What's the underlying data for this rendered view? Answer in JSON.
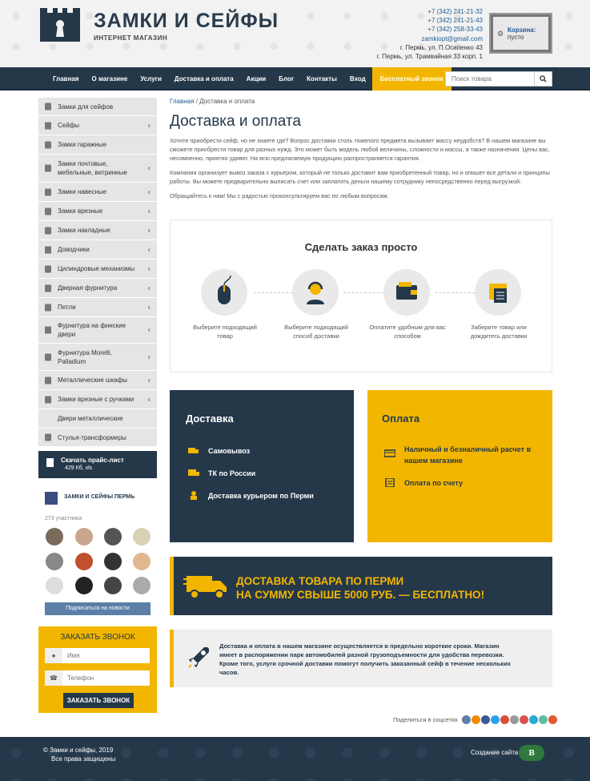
{
  "header": {
    "brand": "ЗАМКИ И СЕЙФЫ",
    "tagline": "ИНТЕРНЕТ МАГАЗИН",
    "phones": [
      "+7 (342) 241-21-32",
      "+7 (342) 241-21-43",
      "+7 (342) 258-33-43"
    ],
    "email": "zamkiopt@gmail.com",
    "addresses": [
      "г. Пермь, ул. П.Осипенко 43",
      "г. Пермь, ул. Трамвайная 33 корп. 1"
    ],
    "cart_title": "Корзина:",
    "cart_value": "пусто"
  },
  "nav": {
    "items": [
      "Главная",
      "О магазине",
      "Услуги",
      "Доставка и оплата",
      "Акции",
      "Блог",
      "Контакты",
      "Вход"
    ],
    "callback": "Бесплатный звонок",
    "search_placeholder": "Поиск товара"
  },
  "sidebar": {
    "items": [
      {
        "label": "Замки для сейфов",
        "sub": false
      },
      {
        "label": "Сейфы",
        "sub": true
      },
      {
        "label": "Замки гаражные",
        "sub": false
      },
      {
        "label": "Замки почтовые, мебельные, витринные",
        "sub": true
      },
      {
        "label": "Замки навесные",
        "sub": true
      },
      {
        "label": "Замки врезные",
        "sub": true
      },
      {
        "label": "Замки накладные",
        "sub": true
      },
      {
        "label": "Доводчики",
        "sub": true
      },
      {
        "label": "Цилиндровые механизмы",
        "sub": true
      },
      {
        "label": "Дверная фурнитура",
        "sub": true
      },
      {
        "label": "Петли",
        "sub": true
      },
      {
        "label": "Фурнитура на финские двери",
        "sub": true
      },
      {
        "label": "Фурнитура Morelli, Palladium",
        "sub": true
      },
      {
        "label": "Металлические шкафы",
        "sub": true
      },
      {
        "label": "Замки врезные с ручками",
        "sub": true
      },
      {
        "label": "Двери металлические",
        "sub": false
      },
      {
        "label": "Стулья-трансформеры",
        "sub": false
      }
    ],
    "pricelist": "Скачать прайс-лист",
    "pricelist_size": "429 Кб, xls"
  },
  "vk": {
    "title": "ЗАМКИ И СЕЙФЫ ПЕРМЬ",
    "count": "273 участника",
    "button": "Подписаться на новости"
  },
  "callback_form": {
    "title": "ЗАКАЗАТЬ ЗВОНОК",
    "name_placeholder": "Имя",
    "phone_placeholder": "Телефон",
    "submit": "ЗАКАЗАТЬ ЗВОНОК"
  },
  "breadcrumb": {
    "home": "Главная",
    "sep": "/",
    "current": "Доставка и оплата"
  },
  "page": {
    "title": "Доставка и оплата",
    "paragraphs": [
      "Хотите приобрести сейф, но не знаете где? Вопрос доставки столь тяжелого предмета вызывает массу неудобств? В нашем магазине вы сможете приобрести товар для разных нужд. Это может быть модель любой величины, сложности и массы, а также назначения. Цены вас, несомненно, приятно удивят. На всю предлагаемую продукцию распространяется гарантия.",
      "Компания организует вывоз заказа с курьером, который не только доставит вам приобретенный товар, но и опишет все детали и принципы работы. Вы можете предварительно выписать счет или заплатить деньги нашему сотруднику непосредственно перед выгрузкой.",
      "Обращайтесь к нам! Мы с радостью проконсультируем вас по любым вопросам."
    ]
  },
  "steps": {
    "title": "Сделать заказ просто",
    "items": [
      {
        "caption": "Выберите подходящий товар",
        "icon": "mouse-icon"
      },
      {
        "caption": "Выберите подходящий способ доставки",
        "icon": "operator-icon"
      },
      {
        "caption": "Оплатите удобным для вас способом",
        "icon": "wallet-icon"
      },
      {
        "caption": "Заберите товар или дождитесь доставки",
        "icon": "box-icon"
      }
    ]
  },
  "delivery": {
    "title": "Доставка",
    "items": [
      "Самовывоз",
      "ТК по России",
      "Доставка курьером по Перми"
    ]
  },
  "payment": {
    "title": "Оплата",
    "items": [
      "Наличный и безналичный расчет в нашем магазине",
      "Оплата по счету"
    ]
  },
  "banner": {
    "line1": "ДОСТАВКА ТОВАРА ПО ПЕРМИ",
    "line2": "НА СУММУ СВЫШЕ 5000 РУБ. — БЕСПЛАТНО!"
  },
  "note": "Доставка и оплата в нашем магазине осуществляется в предельно короткие сроки. Магазин имеет в распоряжении парк автомобилей разной грузоподъемности для удобства перевозки. Кроме того, услуги срочной доставки помогут получить заказанный сейф в течение нескольких часов.",
  "share": {
    "label": "Поделиться в соцсетях",
    "colors": [
      "#5b7fa6",
      "#f08c00",
      "#3b5998",
      "#2aa3ef",
      "#dd4b39",
      "#999999",
      "#d9534f",
      "#2aabd2",
      "#5bc0a0",
      "#e05b2e"
    ]
  },
  "footer": {
    "copy1": "© Замки и сейфы, 2019",
    "copy2": "Все права защищены",
    "made": "Создание сайта",
    "made_logo": "B"
  },
  "colors": {
    "navy": "#25384a",
    "accent": "#f2b600"
  }
}
